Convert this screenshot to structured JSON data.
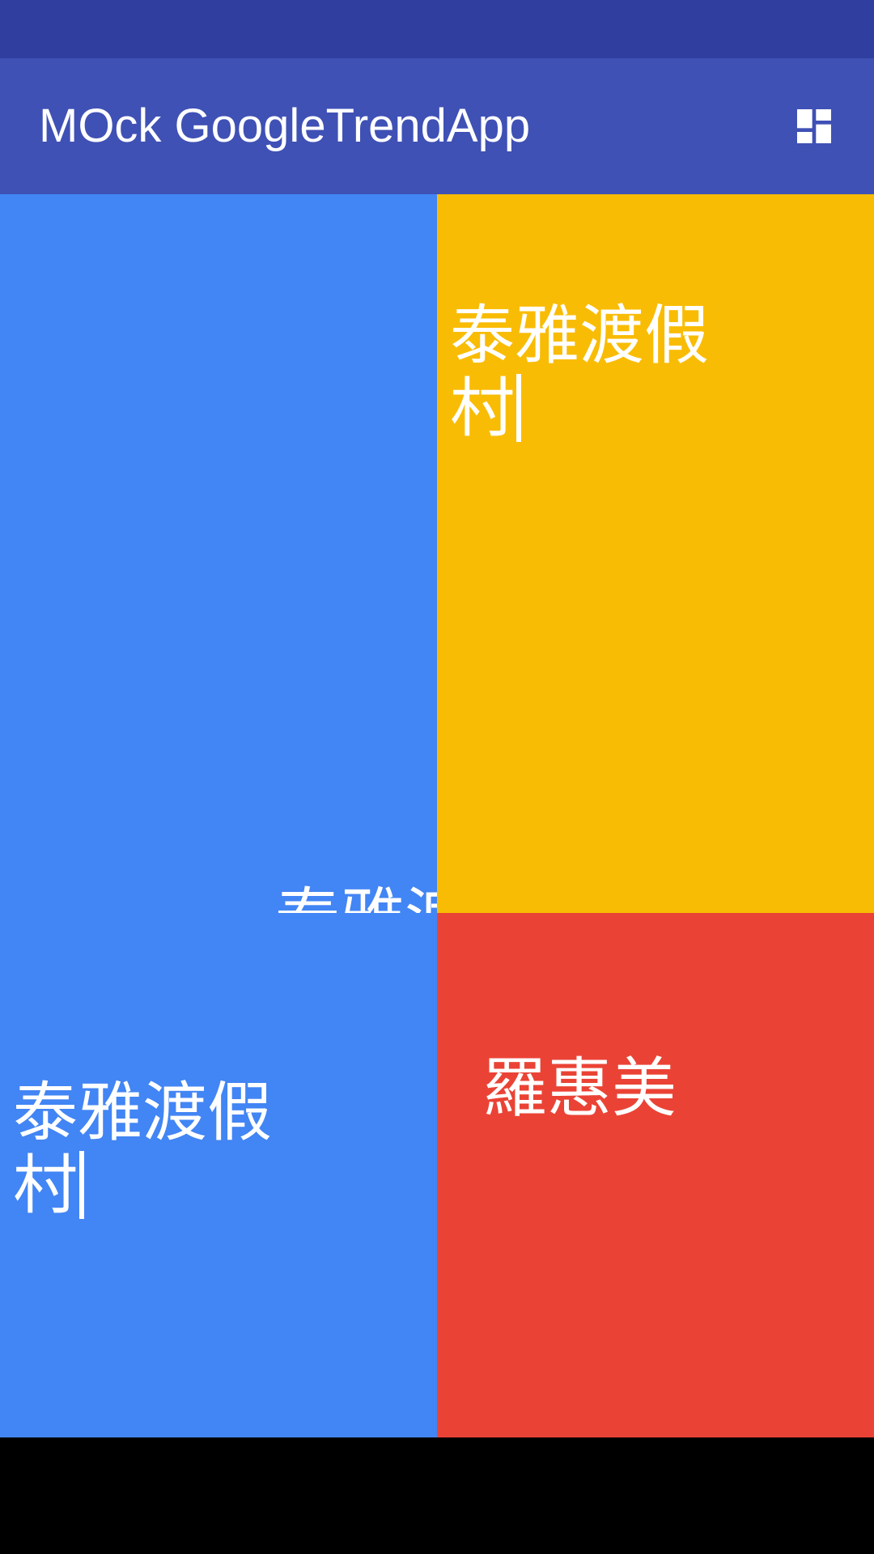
{
  "app": {
    "title": "MOck GoogleTrendApp"
  },
  "toolbar": {
    "layout_icon": "dashboard-layout-icon"
  },
  "colors": {
    "status_bar": "#303F9F",
    "app_bar": "#3F51B5",
    "tile_blue": "#4285F4",
    "tile_yellow": "#F9BC05",
    "tile_red": "#EA4335",
    "nav_bar": "#000000"
  },
  "tiles": [
    {
      "color": "#4285F4",
      "term": "泰雅渡假村",
      "incoming_term": "泰雅渡"
    },
    {
      "color": "#F9BC05",
      "term": "泰雅渡假村"
    },
    {
      "color": "#EA4335",
      "term": "羅惠美"
    }
  ]
}
